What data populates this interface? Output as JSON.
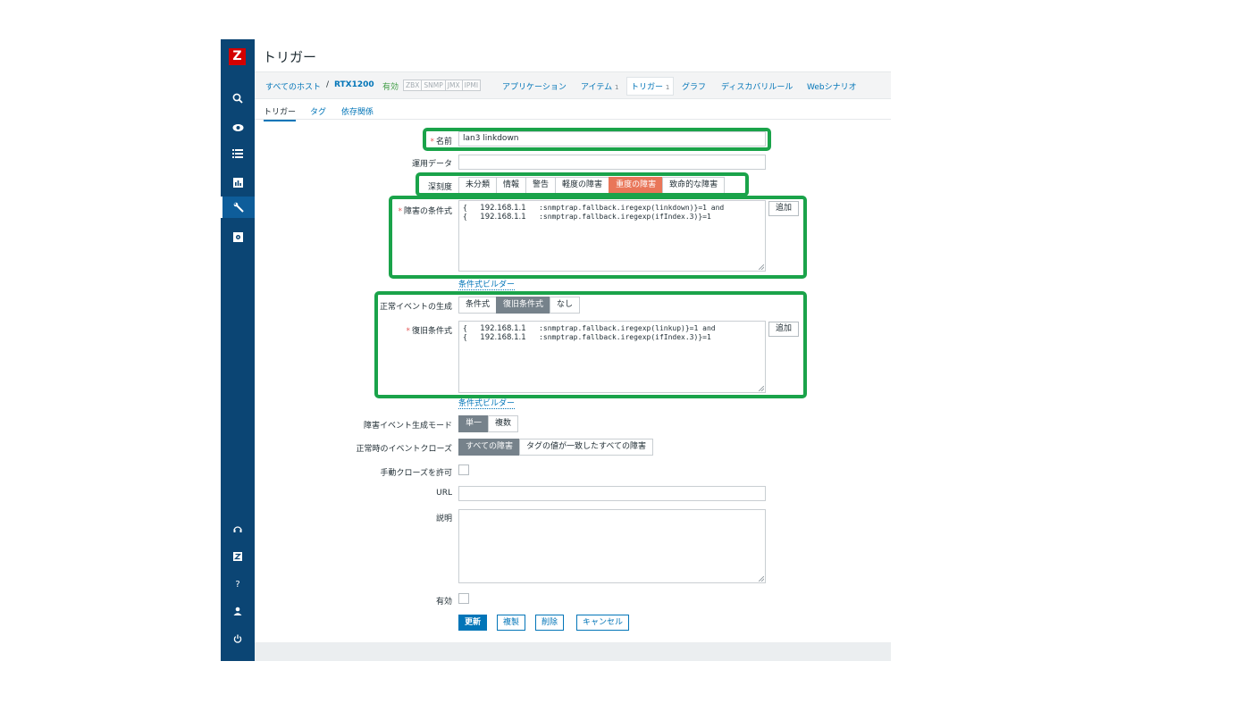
{
  "app": {
    "logo": "Z",
    "page_title": "トリガー"
  },
  "sidebar": {
    "items": [
      "search-icon",
      "eye-icon",
      "list-icon",
      "chart-icon",
      "wrench-icon",
      "gear-icon",
      "support-icon",
      "zabbix-share-icon",
      "help-icon",
      "user-icon",
      "power-icon"
    ]
  },
  "hostnav": {
    "all_hosts": "すべてのホスト",
    "sep": "/",
    "host": "RTX1200",
    "status": "有効",
    "badges": [
      "ZBX",
      "SNMP",
      "JMX",
      "IPMI"
    ],
    "applications": "アプリケーション",
    "items": "アイテム",
    "items_count": "1",
    "triggers": "トリガー",
    "triggers_count": "1",
    "graphs": "グラフ",
    "discovery": "ディスカバリルール",
    "web": "Webシナリオ"
  },
  "subtabs": [
    "トリガー",
    "タグ",
    "依存関係"
  ],
  "form": {
    "name_label": "名前",
    "name_value": "lan3 linkdown",
    "opdata_label": "運用データ",
    "opdata_value": "",
    "severity_label": "深刻度",
    "severity_options": [
      "未分類",
      "情報",
      "警告",
      "軽度の障害",
      "重度の障害",
      "致命的な障害"
    ],
    "severity_selected": "重度の障害",
    "problem_expr_label": "障害の条件式",
    "problem_expr_lines": [
      {
        "brace": "{",
        "ip": "192.168.1.1",
        "expr": ":snmptrap.fallback.iregexp(linkdown)}=1 and"
      },
      {
        "brace": "{",
        "ip": "192.168.1.1",
        "expr": ":snmptrap.fallback.iregexp(ifIndex.3)}=1"
      }
    ],
    "add_label": "追加",
    "expr_builder": "条件式ビルダー",
    "ok_gen_label": "正常イベントの生成",
    "ok_gen_options": [
      "条件式",
      "復旧条件式",
      "なし"
    ],
    "ok_gen_selected": "復旧条件式",
    "recovery_expr_label": "復旧条件式",
    "recovery_expr_lines": [
      {
        "brace": "{",
        "ip": "192.168.1.1",
        "expr": ":snmptrap.fallback.iregexp(linkup)}=1 and"
      },
      {
        "brace": "{",
        "ip": "192.168.1.1",
        "expr": ":snmptrap.fallback.iregexp(ifIndex.3)}=1"
      }
    ],
    "mode_label": "障害イベント生成モード",
    "mode_options": [
      "単一",
      "複数"
    ],
    "mode_selected": "単一",
    "close_label": "正常時のイベントクローズ",
    "close_options": [
      "すべての障害",
      "タグの値が一致したすべての障害"
    ],
    "close_selected": "すべての障害",
    "manual_close_label": "手動クローズを許可",
    "manual_close_checked": false,
    "url_label": "URL",
    "url_value": "",
    "desc_label": "説明",
    "desc_value": "",
    "enabled_label": "有効",
    "enabled_checked": false
  },
  "actions": {
    "update": "更新",
    "clone": "複製",
    "delete": "削除",
    "cancel": "キャンセル"
  },
  "colors": {
    "sidebar": "#0b4574",
    "accent": "#0275b8",
    "severity_high": "#e97659",
    "highlight_box": "#1aa34a",
    "logo": "#d40000"
  }
}
